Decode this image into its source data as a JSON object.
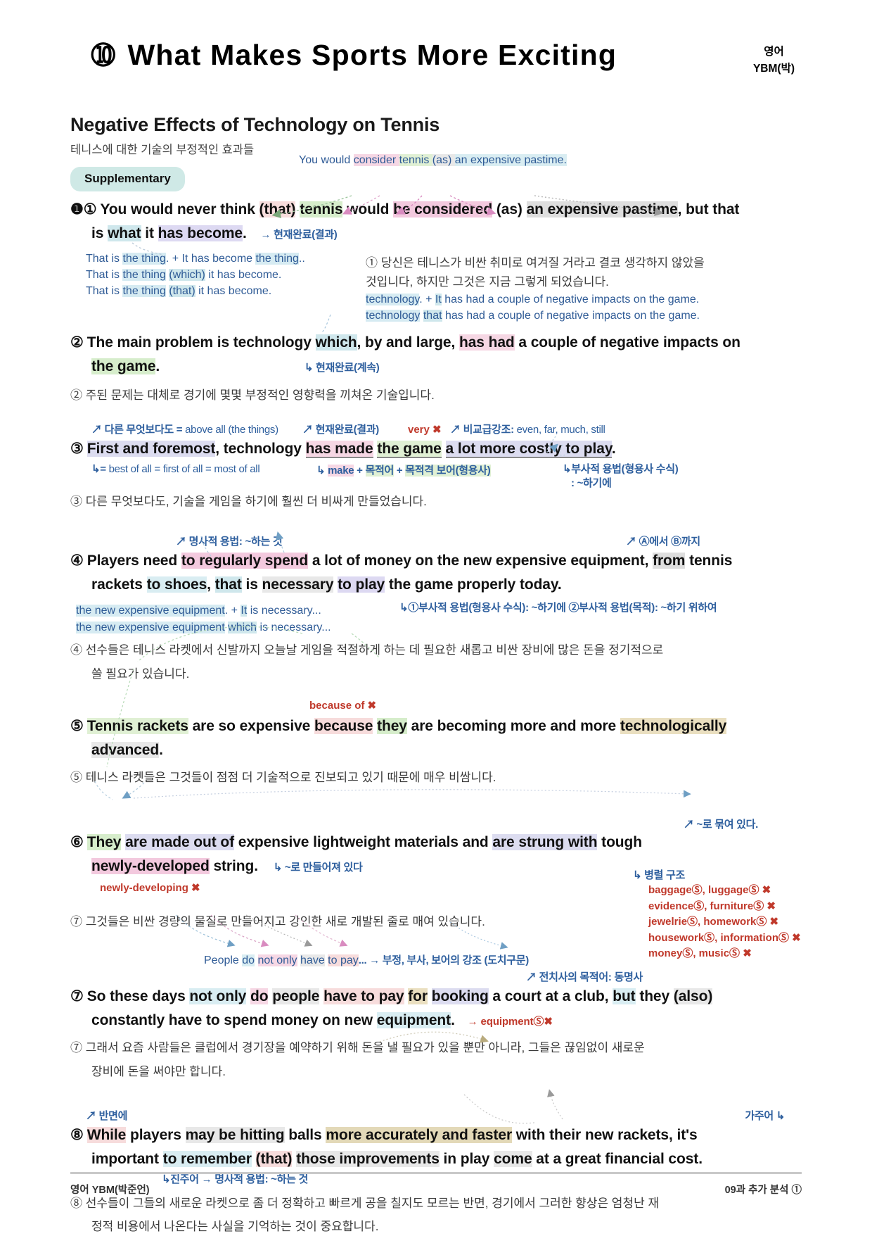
{
  "header": {
    "lesson_number": "➉",
    "title": "What Makes Sports More Exciting",
    "subject": "영어",
    "publisher": "YBM(박)"
  },
  "section": {
    "title": "Negative Effects of Technology on Tennis",
    "subtitle": "테니스에 대한 기술의 부정적인 효과들",
    "badge": "Supplementary"
  },
  "s1": {
    "top_quote_a": "You would ",
    "top_quote_b": "consider ",
    "top_quote_c": "tennis ",
    "top_quote_d": "(as) ",
    "top_quote_e": "an expensive pastime.",
    "num": "❶①",
    "t1": "You would never think ",
    "t2": "(that)",
    "t3": " ",
    "t4": "tennis",
    "t5": " would ",
    "t6": "be considered",
    "t7": " (as) ",
    "t8": "an expensive pastime",
    "t9": ", but that",
    "t10": "is ",
    "t11": "what",
    "t12": " it ",
    "t13": "has become",
    "t14": ".",
    "note": "→ 현재완료(결과)",
    "blue1a": "That is ",
    "blue1b": "the thing",
    "blue1c": ". + It has become ",
    "blue1d": "the thing",
    "blue1e": "..",
    "blue2a": "That is ",
    "blue2b": "the thing",
    "blue2c": " ",
    "blue2d": "(which)",
    "blue2e": " it has become.",
    "blue3a": "That is ",
    "blue3b": "the thing",
    "blue3c": " ",
    "blue3d": "(that)",
    "blue3e": " it has become.",
    "kor": "① 당신은 테니스가 비싼 취미로 여겨질 거라고 결코 생각하지 않았을",
    "kor2": "것입니다, 하지만 그것은 지금 그렇게 되었습니다."
  },
  "s2": {
    "blue1a": "technology",
    "blue1b": ". + ",
    "blue1c": "It",
    "blue1d": " has had a couple of negative impacts on the game.",
    "blue2a": "technology",
    "blue2b": " ",
    "blue2c": "that",
    "blue2d": " has had a couple of negative impacts on the game.",
    "num": "②",
    "t1": "The main problem is technology ",
    "t2": "which",
    "t3": ", by and large, ",
    "t4": "has had",
    "t5": " a couple of negative impacts on",
    "t6": "the game",
    "t7": ".",
    "note": "↳ 현재완료(계속)",
    "kor": "② 주된 문제는 대체로 경기에 몇몇 부정적인 영향력을 끼쳐온 기술입니다."
  },
  "s3": {
    "ann1": "↗ 다른 무엇보다도 = ",
    "ann1b": "above all (the things)",
    "ann2": "↗ 현재완료(결과)",
    "ann3": "very ✖",
    "ann4": "↗ 비교급강조: ",
    "ann4b": "even, far, much, still",
    "num": "③",
    "t1": "First and foremost",
    "t2": ", technology ",
    "t3": "has made",
    "t4": " ",
    "t5": "the game",
    "t6": " ",
    "t7": "a lot more costly to play",
    "t8": ".",
    "note1": "↳= ",
    "note1b": "best of all = first of all = most of all",
    "note2a": "↳ ",
    "note2b": "make",
    "note2c": " + ",
    "note2d": "목적어",
    "note2e": " + ",
    "note2f": "목적격 보어(형용사)",
    "note3": "↳부사적 용법(형용사 수식)",
    "note3b": ": ~하기에",
    "kor": "③ 다른 무엇보다도, 기술을 게임을 하기에 훨씬 더 비싸게 만들었습니다."
  },
  "s4": {
    "ann1": "↗ 명사적 용법: ~하는 것",
    "ann2": "↗ Ⓐ에서 Ⓑ까지",
    "num": "④",
    "t1": "Players need ",
    "t2": "to regularly spend",
    "t3": " a lot of money on the new expensive equipment, ",
    "t4": "from",
    "t5": " tennis",
    "t6": "rackets ",
    "t7": "to shoes",
    "t8": ", ",
    "t9": "that",
    "t10": " is ",
    "t11": "necessary",
    "t12": " ",
    "t13": "to play",
    "t14": " the game properly today.",
    "blue1a": "the new expensive equipment",
    "blue1b": ". + ",
    "blue1c": "It",
    "blue1d": " is necessary...",
    "blue2a": "the new expensive equipment",
    "blue2b": " ",
    "blue2c": "which",
    "blue2d": " is necessary...",
    "note": "↳①부사적 용법(형용사 수식): ~하기에 ②부사적 용법(목적): ~하기 위하여",
    "kor": "④ 선수들은 테니스 라켓에서 신발까지 오늘날 게임을 적절하게 하는 데 필요한 새롭고 비싼 장비에 많은 돈을 정기적으로",
    "kor2": "쓸 필요가 있습니다."
  },
  "s5": {
    "ann": "because of ✖",
    "num": "⑤",
    "t1": "Tennis rackets",
    "t2": " are so expensive ",
    "t3": "because",
    "t4": " ",
    "t5": "they",
    "t6": " are becoming more and more ",
    "t7": "technologically",
    "t8": "advanced",
    "t9": ".",
    "kor": "⑤ 테니스 라켓들은 그것들이 점점 더 기술적으로 진보되고 있기 때문에 매우 비쌈니다."
  },
  "s6": {
    "ann_top": "↗ ~로 묶여 있다.",
    "num": "⑥",
    "t1": "They",
    "t2": " ",
    "t3": "are made out of",
    "t4": " expensive lightweight materials and ",
    "t5": "are strung with",
    "t6": " tough",
    "t7": "newly-developed",
    "t8": " string",
    "t9": ".",
    "note1": "↳ ~로 만들어져 있다",
    "note2": "newly-developing ✖",
    "note3": "↳ 병렬 구조",
    "red_list": [
      "baggageⓈ, luggageⓈ ✖",
      "evidenceⓈ, furnitureⓈ ✖",
      "jewelrieⓈ, homeworkⓈ ✖",
      "houseworkⓈ, informationⓈ ✖",
      "moneyⓈ, musicⓈ ✖"
    ],
    "kor": "⑦ 그것들은 비싼 경량의 물질로 만들어지고 강인한 새로 개발된 줄로 매여 있습니다."
  },
  "s7": {
    "ann_top_a": "People ",
    "ann_top_b": "do",
    "ann_top_c": " ",
    "ann_top_d": "not only",
    "ann_top_e": " ",
    "ann_top_f": "have",
    "ann_top_g": " ",
    "ann_top_h": "to pay",
    "ann_top_i": "... → 부정, 부사, 보어의 강조 (도치구문)",
    "ann2": "↗ 전치사의 목적어: 동명사",
    "num": "⑦",
    "t1": "So these days ",
    "t2": "not only",
    "t3": " ",
    "t4": "do",
    "t5": " ",
    "t6": "people",
    "t7": " ",
    "t8": "have to pay",
    "t9": " ",
    "t10": "for",
    "t11": " ",
    "t12": "booking",
    "t13": " a court at a club, ",
    "t14": "but",
    "t15": " they ",
    "t16": "(also)",
    "t17": "constantly have to spend money on new ",
    "t18": "equipment",
    "t19": ".",
    "note": "→ equipmentⓈ✖",
    "kor": "⑦ 그래서 요즘 사람들은 클럽에서 경기장을 예약하기 위해 돈을 낼 필요가 있을 뿐만 아니라, 그들은 끊임없이 새로운",
    "kor2": "장비에 돈을 써야만 합니다."
  },
  "s8": {
    "ann1": "↗ 반면에",
    "ann2": "가주어 ↳",
    "num": "⑧",
    "t1": "While",
    "t2": " players ",
    "t3": "may be hitting",
    "t4": " balls ",
    "t5": "more accurately and faster",
    "t6": " with their new rackets, ",
    "t7": "it's",
    "t8": "important ",
    "t9": "to remember",
    "t10": " ",
    "t11": "(that)",
    "t12": " ",
    "t13": "those improvements",
    "t14": " in play ",
    "t15": "come",
    "t16": " at a great financial cost",
    "t17": ".",
    "note": "↳진주어 → 명사적 용법: ~하는 것",
    "kor": "⑧ 선수들이 그들의 새로운 라켓으로 좀 더 정확하고 빠르게 공을 칠지도 모르는 반면, 경기에서 그러한 향상은 엄청난 재",
    "kor2": "정적 비용에서 나온다는 사실을 기억하는 것이 중요합니다."
  },
  "footer": {
    "left": "영어 YBM(박준언)",
    "right": "09과 추가 분석 ①"
  }
}
